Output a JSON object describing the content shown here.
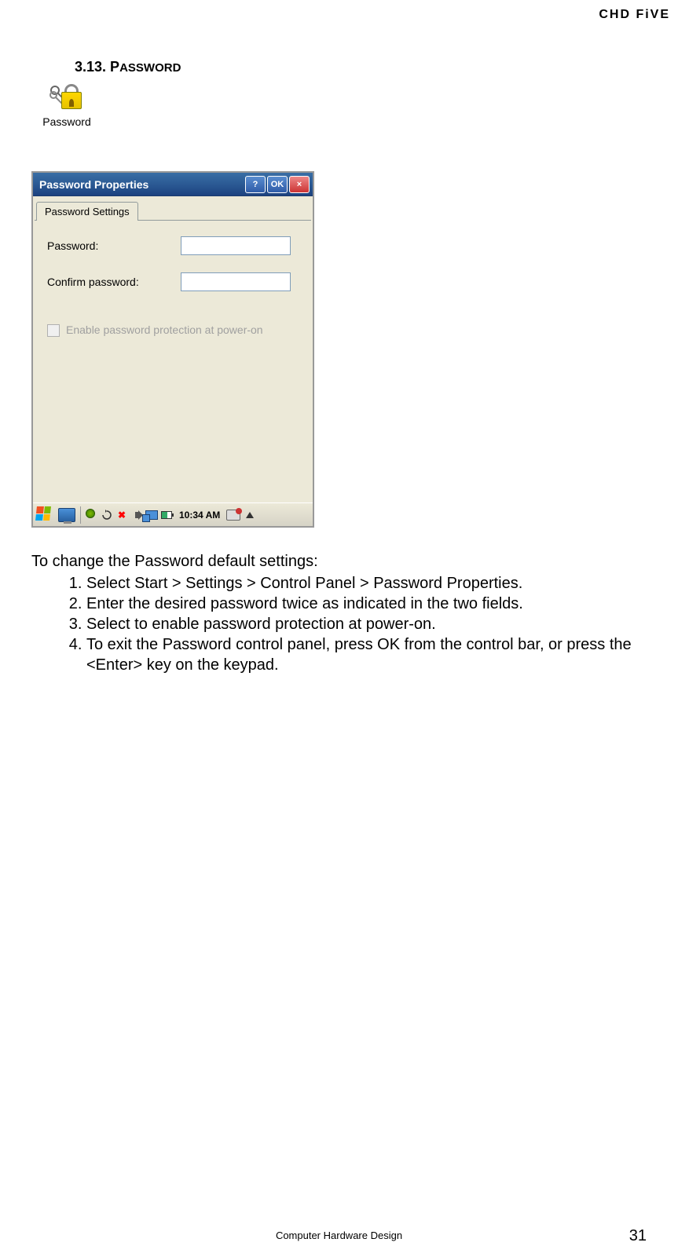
{
  "header": {
    "brand": "CHD FiVE"
  },
  "section": {
    "number": "3.13. ",
    "title_first": "P",
    "title_rest": "ASSWORD"
  },
  "icon": {
    "label": "Password"
  },
  "dialog": {
    "title": "Password Properties",
    "help": "?",
    "ok": "OK",
    "close": "×",
    "tab": "Password Settings",
    "password_label": "Password:",
    "password_value": "",
    "confirm_label": "Confirm password:",
    "confirm_value": "",
    "checkbox_label": "Enable password protection at power-on"
  },
  "taskbar": {
    "time": "10:34 AM"
  },
  "instructions": {
    "intro": "To change the Password default settings:",
    "items": [
      "Select Start > Settings > Control Panel > Password Properties.",
      "Enter the desired password twice as indicated in the two fields.",
      "Select to enable password protection at power-on.",
      "To exit the Password control panel, press OK from the control bar, or press the <Enter> key on the keypad."
    ]
  },
  "footer": {
    "text": "Computer Hardware Design",
    "page": "31"
  }
}
